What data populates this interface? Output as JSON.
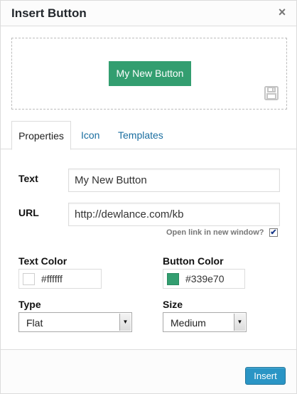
{
  "dialog": {
    "title": "Insert Button",
    "close_label": "×"
  },
  "preview": {
    "button_label": "My New Button",
    "button_color": "#339e70",
    "save_icon": "floppy-disk-icon"
  },
  "tabs": [
    {
      "label": "Properties",
      "active": true
    },
    {
      "label": "Icon",
      "active": false
    },
    {
      "label": "Templates",
      "active": false
    }
  ],
  "form": {
    "text_label": "Text",
    "text_value": "My New Button",
    "url_label": "URL",
    "url_value": "http://dewlance.com/kb",
    "new_window_label": "Open link in new window?",
    "new_window_checked": true,
    "check_mark": "✔",
    "text_color_label": "Text Color",
    "text_color_value": "#ffffff",
    "button_color_label": "Button Color",
    "button_color_value": "#339e70",
    "type_label": "Type",
    "type_value": "Flat",
    "size_label": "Size",
    "size_value": "Medium",
    "select_arrow": "▼"
  },
  "footer": {
    "insert_label": "Insert"
  },
  "colors": {
    "accent": "#339e70",
    "link": "#1a6ea0",
    "primary_button": "#2a95c5"
  }
}
